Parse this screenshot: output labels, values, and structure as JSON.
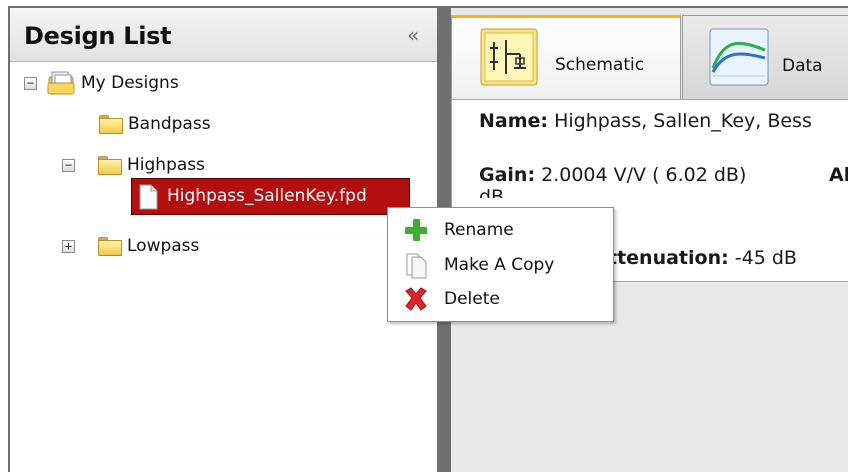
{
  "design_list": {
    "title": "Design List",
    "collapse_glyph": "«",
    "tree": {
      "root": {
        "label": "My Designs",
        "expander": "−"
      },
      "bandpass": {
        "label": "Bandpass"
      },
      "highpass": {
        "label": "Highpass",
        "expander": "−"
      },
      "highpass_file": {
        "label": "Highpass_SallenKey.fpd"
      },
      "lowpass": {
        "label": "Lowpass",
        "expander": "+"
      }
    }
  },
  "tabs": [
    {
      "label": "Schematic",
      "icon": "schematic-icon"
    },
    {
      "label": "Data",
      "icon": "data-graph-icon"
    }
  ],
  "summary": {
    "name_label": "Name:",
    "name_value": "Highpass, Sallen_Key, Bess",
    "gain_label": "Gain:",
    "gain_value": "2.0004 V/V ( 6.02 dB)",
    "gain_extra": "Al",
    "gain_wrap": "dB",
    "atten_label": "ttenuation:",
    "atten_value": "-45 dB"
  },
  "context_menu": {
    "items": [
      {
        "label": "Rename",
        "icon": "plus-icon"
      },
      {
        "label": "Make A Copy",
        "icon": "copy-document-icon"
      },
      {
        "label": "Delete",
        "icon": "delete-x-icon"
      }
    ]
  },
  "colors": {
    "selection": "#b30f0f",
    "active_tab_accent": "#f3b219",
    "rename_icon": "#3fae2a",
    "delete_icon": "#e0232b"
  }
}
